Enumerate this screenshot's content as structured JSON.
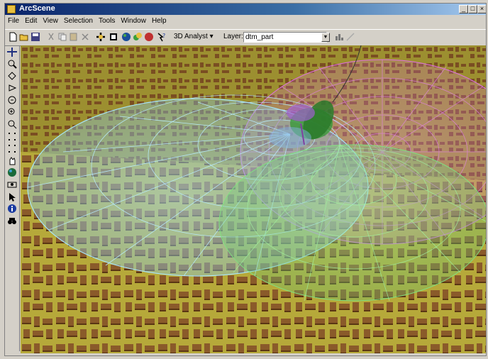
{
  "window": {
    "title": "ArcScene"
  },
  "menubar": {
    "items": [
      "File",
      "Edit",
      "View",
      "Selection",
      "Tools",
      "Window",
      "Help"
    ]
  },
  "toolbar": {
    "analyst_label": "3D Analyst ▾",
    "layer_label": "Layer:",
    "layer_value": "dtm_part"
  },
  "colors": {
    "terrain": "#b6a93a",
    "buildings": "#8a5a2a",
    "dome_blue": "#8fd0ea",
    "dome_magenta": "#e070e0",
    "dome_green": "#70d070"
  }
}
